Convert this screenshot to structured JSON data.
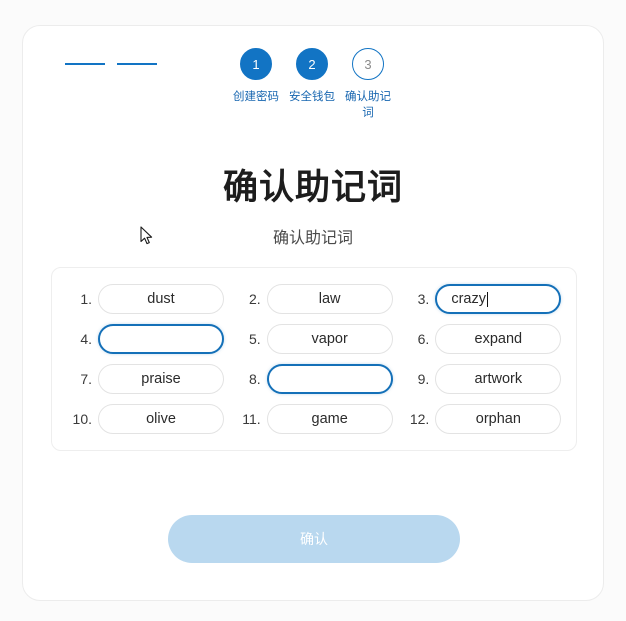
{
  "stepper": {
    "steps": [
      {
        "number": "1",
        "label": "创建密码",
        "state": "done"
      },
      {
        "number": "2",
        "label": "安全钱包",
        "state": "done"
      },
      {
        "number": "3",
        "label": "确认助记词",
        "state": "todo"
      }
    ]
  },
  "heading": {
    "title": "确认助记词",
    "subtitle": "确认助记词"
  },
  "words": [
    {
      "num": "1.",
      "value": "dust",
      "focused": false
    },
    {
      "num": "2.",
      "value": "law",
      "focused": false
    },
    {
      "num": "3.",
      "value": "crazy",
      "focused": true
    },
    {
      "num": "4.",
      "value": "",
      "focused": true
    },
    {
      "num": "5.",
      "value": "vapor",
      "focused": false
    },
    {
      "num": "6.",
      "value": "expand",
      "focused": false
    },
    {
      "num": "7.",
      "value": "praise",
      "focused": false
    },
    {
      "num": "8.",
      "value": "",
      "focused": true
    },
    {
      "num": "9.",
      "value": "artwork",
      "focused": false
    },
    {
      "num": "10.",
      "value": "olive",
      "focused": false
    },
    {
      "num": "11.",
      "value": "game",
      "focused": false
    },
    {
      "num": "12.",
      "value": "orphan",
      "focused": false
    }
  ],
  "confirm": {
    "label": "确认",
    "enabled": false
  },
  "colors": {
    "accent": "#1274c4",
    "step_label": "#1766b0",
    "focus_border": "#1470b8",
    "button_disabled": "#b9d8ef",
    "pill_border": "#e3e3e3",
    "card_border": "#ececec",
    "page_background": "#fbfbfb"
  }
}
